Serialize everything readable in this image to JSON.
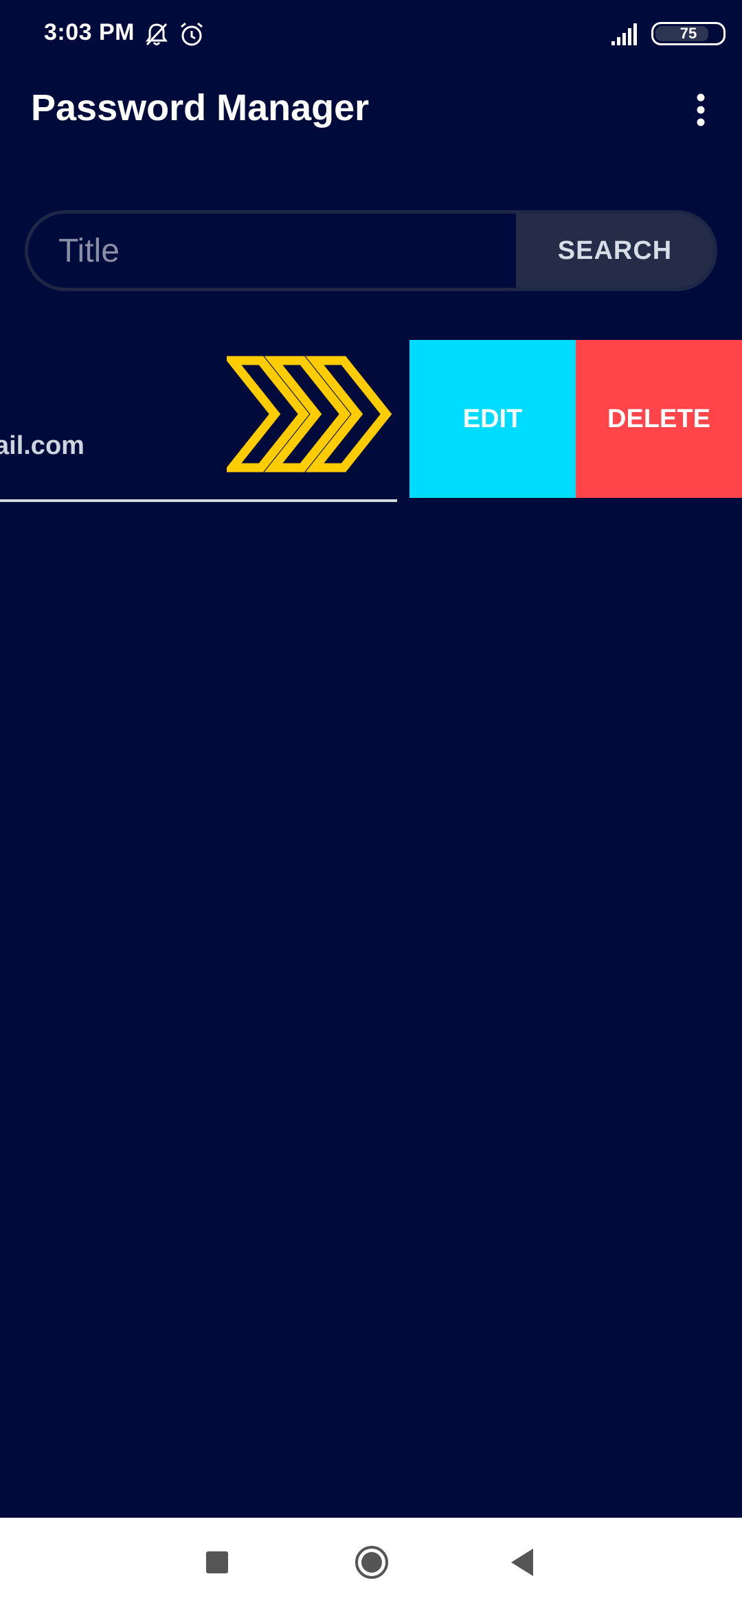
{
  "status_bar": {
    "time": "3:03 PM",
    "battery_level": "75",
    "icons": [
      "muted-bell-icon",
      "alarm-clock-icon",
      "signal-icon",
      "battery-icon"
    ]
  },
  "app_bar": {
    "title": "Password Manager",
    "menu_icon": "more-vert-icon"
  },
  "search": {
    "placeholder": "Title",
    "value": "",
    "button_label": "SEARCH"
  },
  "list": {
    "items": [
      {
        "subtitle_visible": "ail.com",
        "swipe_hint_icon": "triple-chevron-right-icon",
        "actions": {
          "edit_label": "EDIT",
          "delete_label": "DELETE"
        }
      }
    ]
  },
  "colors": {
    "background": "#000a3b",
    "edit": "#00dcff",
    "delete": "#ff4549",
    "chevron": "#ffcc00",
    "search_button": "#242c47"
  },
  "nav_bar": {
    "icons": [
      "recents-icon",
      "home-icon",
      "back-icon"
    ]
  }
}
